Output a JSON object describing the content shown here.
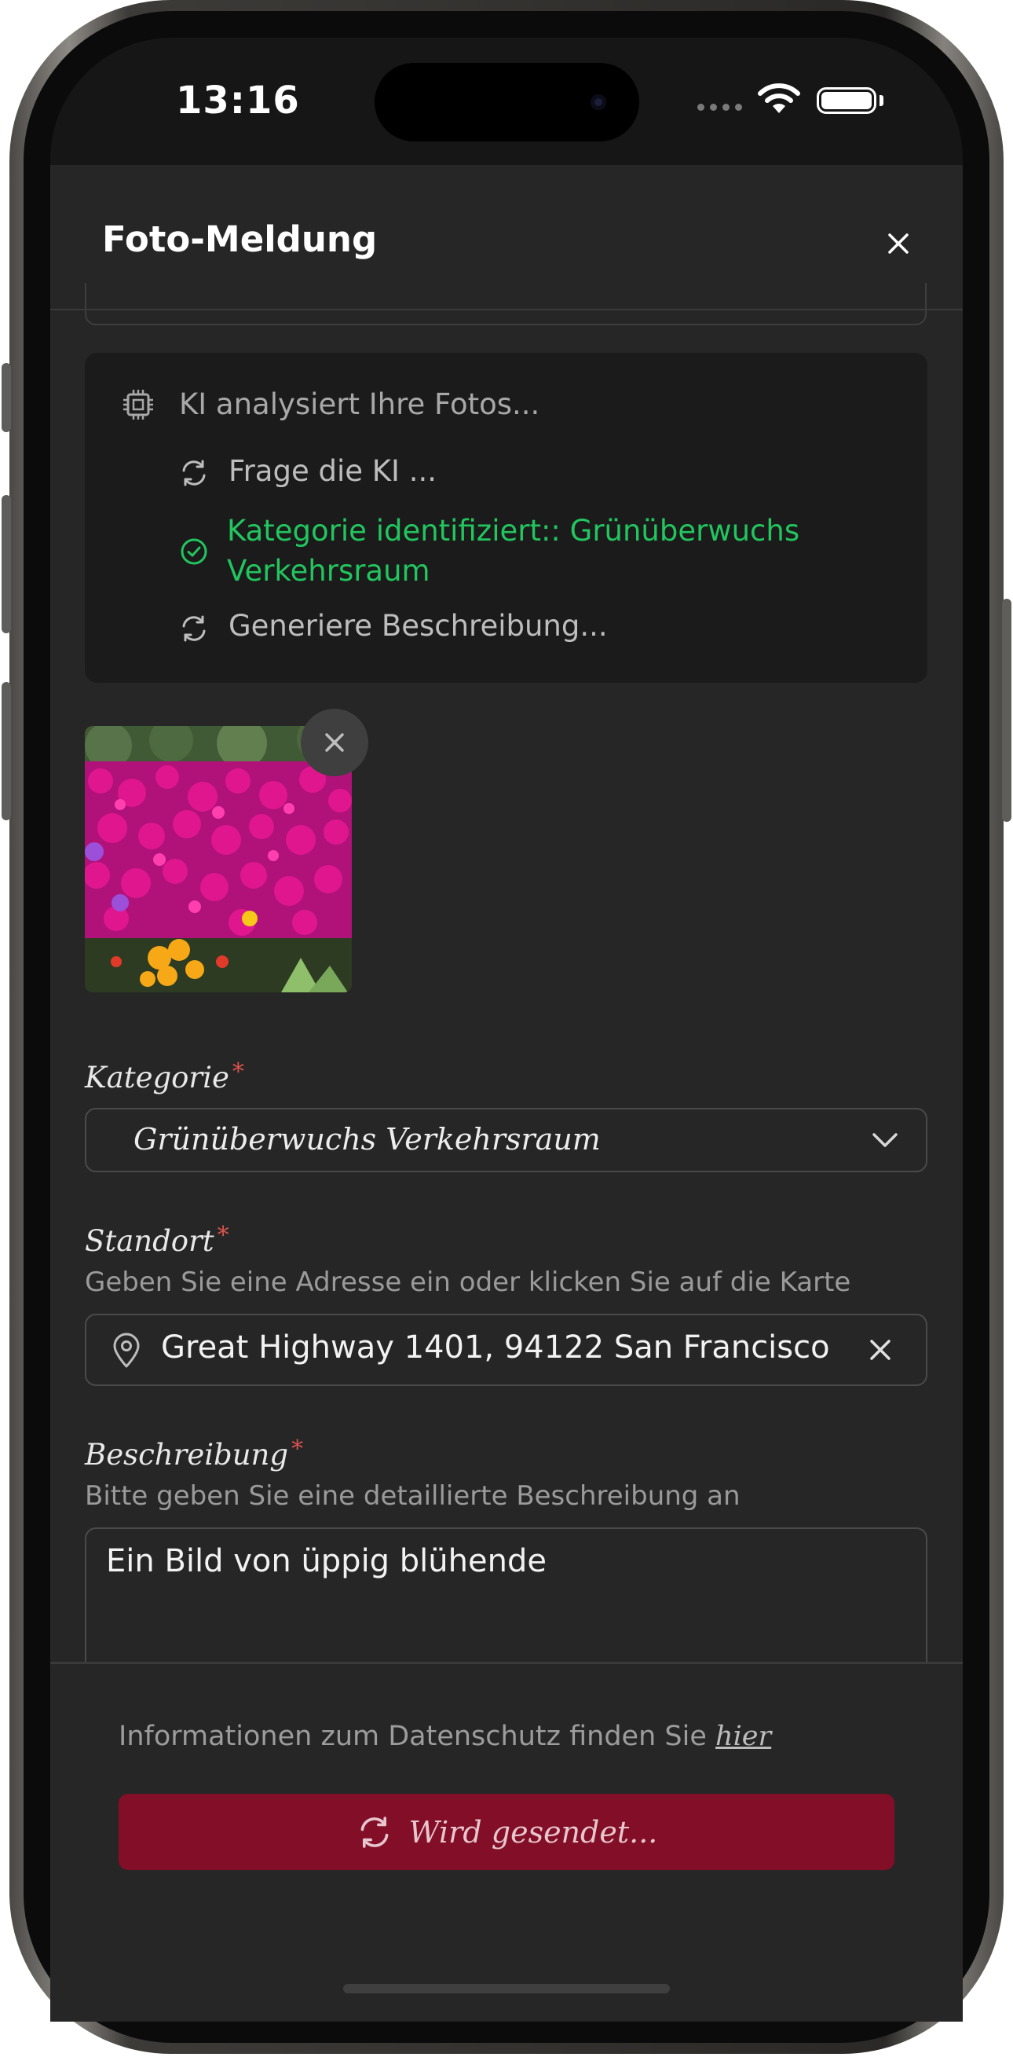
{
  "status_bar": {
    "time": "13:16"
  },
  "header": {
    "title": "Foto-Meldung",
    "close_icon": "close-icon"
  },
  "ai_panel": {
    "title": "KI analysiert Ihre Fotos...",
    "steps": [
      {
        "text": "Frage die KI ...",
        "state": "loading"
      },
      {
        "text_line1": "Kategorie identifiziert:: Grünüberwuchs",
        "text_line2": "Verkehrsraum",
        "state": "done"
      },
      {
        "text": "Generiere Beschreibung...",
        "state": "loading"
      }
    ],
    "colors": {
      "done": "#22c55e",
      "loading": "#bdbdbd"
    }
  },
  "photo": {
    "remove_icon": "close-icon"
  },
  "form": {
    "category": {
      "label": "Kategorie",
      "required_mark": "*",
      "value": "Grünüberwuchs Verkehrsraum"
    },
    "location": {
      "label": "Standort",
      "required_mark": "*",
      "hint": "Geben Sie eine Adresse ein oder klicken Sie auf die Karte",
      "value": "Great Highway 1401, 94122 San Francisco"
    },
    "description": {
      "label": "Beschreibung",
      "required_mark": "*",
      "hint": "Bitte geben Sie eine detaillierte Beschreibung an",
      "value": "Ein Bild von üppig blühende"
    }
  },
  "footer": {
    "privacy_text": "Informationen zum Datenschutz finden Sie",
    "privacy_link": "hier",
    "submit_label": "Wird gesendet...",
    "submit_color": "#820f27"
  }
}
